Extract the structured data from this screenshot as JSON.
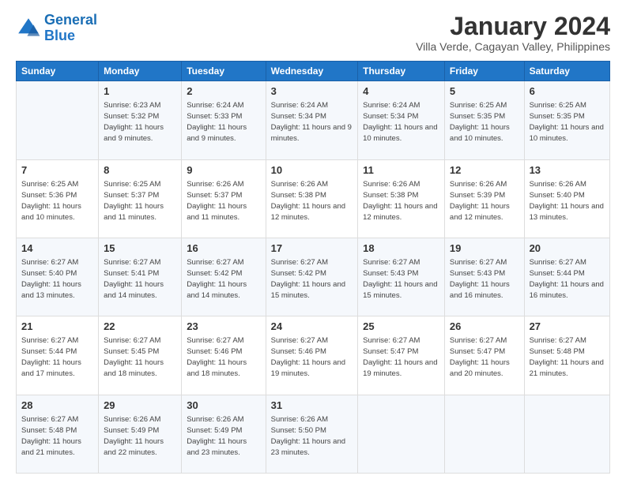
{
  "header": {
    "logo_general": "General",
    "logo_blue": "Blue",
    "main_title": "January 2024",
    "subtitle": "Villa Verde, Cagayan Valley, Philippines"
  },
  "weekdays": [
    "Sunday",
    "Monday",
    "Tuesday",
    "Wednesday",
    "Thursday",
    "Friday",
    "Saturday"
  ],
  "rows": [
    [
      {
        "day": "",
        "sunrise": "",
        "sunset": "",
        "daylight": ""
      },
      {
        "day": "1",
        "sunrise": "Sunrise: 6:23 AM",
        "sunset": "Sunset: 5:32 PM",
        "daylight": "Daylight: 11 hours and 9 minutes."
      },
      {
        "day": "2",
        "sunrise": "Sunrise: 6:24 AM",
        "sunset": "Sunset: 5:33 PM",
        "daylight": "Daylight: 11 hours and 9 minutes."
      },
      {
        "day": "3",
        "sunrise": "Sunrise: 6:24 AM",
        "sunset": "Sunset: 5:34 PM",
        "daylight": "Daylight: 11 hours and 9 minutes."
      },
      {
        "day": "4",
        "sunrise": "Sunrise: 6:24 AM",
        "sunset": "Sunset: 5:34 PM",
        "daylight": "Daylight: 11 hours and 10 minutes."
      },
      {
        "day": "5",
        "sunrise": "Sunrise: 6:25 AM",
        "sunset": "Sunset: 5:35 PM",
        "daylight": "Daylight: 11 hours and 10 minutes."
      },
      {
        "day": "6",
        "sunrise": "Sunrise: 6:25 AM",
        "sunset": "Sunset: 5:35 PM",
        "daylight": "Daylight: 11 hours and 10 minutes."
      }
    ],
    [
      {
        "day": "7",
        "sunrise": "Sunrise: 6:25 AM",
        "sunset": "Sunset: 5:36 PM",
        "daylight": "Daylight: 11 hours and 10 minutes."
      },
      {
        "day": "8",
        "sunrise": "Sunrise: 6:25 AM",
        "sunset": "Sunset: 5:37 PM",
        "daylight": "Daylight: 11 hours and 11 minutes."
      },
      {
        "day": "9",
        "sunrise": "Sunrise: 6:26 AM",
        "sunset": "Sunset: 5:37 PM",
        "daylight": "Daylight: 11 hours and 11 minutes."
      },
      {
        "day": "10",
        "sunrise": "Sunrise: 6:26 AM",
        "sunset": "Sunset: 5:38 PM",
        "daylight": "Daylight: 11 hours and 12 minutes."
      },
      {
        "day": "11",
        "sunrise": "Sunrise: 6:26 AM",
        "sunset": "Sunset: 5:38 PM",
        "daylight": "Daylight: 11 hours and 12 minutes."
      },
      {
        "day": "12",
        "sunrise": "Sunrise: 6:26 AM",
        "sunset": "Sunset: 5:39 PM",
        "daylight": "Daylight: 11 hours and 12 minutes."
      },
      {
        "day": "13",
        "sunrise": "Sunrise: 6:26 AM",
        "sunset": "Sunset: 5:40 PM",
        "daylight": "Daylight: 11 hours and 13 minutes."
      }
    ],
    [
      {
        "day": "14",
        "sunrise": "Sunrise: 6:27 AM",
        "sunset": "Sunset: 5:40 PM",
        "daylight": "Daylight: 11 hours and 13 minutes."
      },
      {
        "day": "15",
        "sunrise": "Sunrise: 6:27 AM",
        "sunset": "Sunset: 5:41 PM",
        "daylight": "Daylight: 11 hours and 14 minutes."
      },
      {
        "day": "16",
        "sunrise": "Sunrise: 6:27 AM",
        "sunset": "Sunset: 5:42 PM",
        "daylight": "Daylight: 11 hours and 14 minutes."
      },
      {
        "day": "17",
        "sunrise": "Sunrise: 6:27 AM",
        "sunset": "Sunset: 5:42 PM",
        "daylight": "Daylight: 11 hours and 15 minutes."
      },
      {
        "day": "18",
        "sunrise": "Sunrise: 6:27 AM",
        "sunset": "Sunset: 5:43 PM",
        "daylight": "Daylight: 11 hours and 15 minutes."
      },
      {
        "day": "19",
        "sunrise": "Sunrise: 6:27 AM",
        "sunset": "Sunset: 5:43 PM",
        "daylight": "Daylight: 11 hours and 16 minutes."
      },
      {
        "day": "20",
        "sunrise": "Sunrise: 6:27 AM",
        "sunset": "Sunset: 5:44 PM",
        "daylight": "Daylight: 11 hours and 16 minutes."
      }
    ],
    [
      {
        "day": "21",
        "sunrise": "Sunrise: 6:27 AM",
        "sunset": "Sunset: 5:44 PM",
        "daylight": "Daylight: 11 hours and 17 minutes."
      },
      {
        "day": "22",
        "sunrise": "Sunrise: 6:27 AM",
        "sunset": "Sunset: 5:45 PM",
        "daylight": "Daylight: 11 hours and 18 minutes."
      },
      {
        "day": "23",
        "sunrise": "Sunrise: 6:27 AM",
        "sunset": "Sunset: 5:46 PM",
        "daylight": "Daylight: 11 hours and 18 minutes."
      },
      {
        "day": "24",
        "sunrise": "Sunrise: 6:27 AM",
        "sunset": "Sunset: 5:46 PM",
        "daylight": "Daylight: 11 hours and 19 minutes."
      },
      {
        "day": "25",
        "sunrise": "Sunrise: 6:27 AM",
        "sunset": "Sunset: 5:47 PM",
        "daylight": "Daylight: 11 hours and 19 minutes."
      },
      {
        "day": "26",
        "sunrise": "Sunrise: 6:27 AM",
        "sunset": "Sunset: 5:47 PM",
        "daylight": "Daylight: 11 hours and 20 minutes."
      },
      {
        "day": "27",
        "sunrise": "Sunrise: 6:27 AM",
        "sunset": "Sunset: 5:48 PM",
        "daylight": "Daylight: 11 hours and 21 minutes."
      }
    ],
    [
      {
        "day": "28",
        "sunrise": "Sunrise: 6:27 AM",
        "sunset": "Sunset: 5:48 PM",
        "daylight": "Daylight: 11 hours and 21 minutes."
      },
      {
        "day": "29",
        "sunrise": "Sunrise: 6:26 AM",
        "sunset": "Sunset: 5:49 PM",
        "daylight": "Daylight: 11 hours and 22 minutes."
      },
      {
        "day": "30",
        "sunrise": "Sunrise: 6:26 AM",
        "sunset": "Sunset: 5:49 PM",
        "daylight": "Daylight: 11 hours and 23 minutes."
      },
      {
        "day": "31",
        "sunrise": "Sunrise: 6:26 AM",
        "sunset": "Sunset: 5:50 PM",
        "daylight": "Daylight: 11 hours and 23 minutes."
      },
      {
        "day": "",
        "sunrise": "",
        "sunset": "",
        "daylight": ""
      },
      {
        "day": "",
        "sunrise": "",
        "sunset": "",
        "daylight": ""
      },
      {
        "day": "",
        "sunrise": "",
        "sunset": "",
        "daylight": ""
      }
    ]
  ]
}
